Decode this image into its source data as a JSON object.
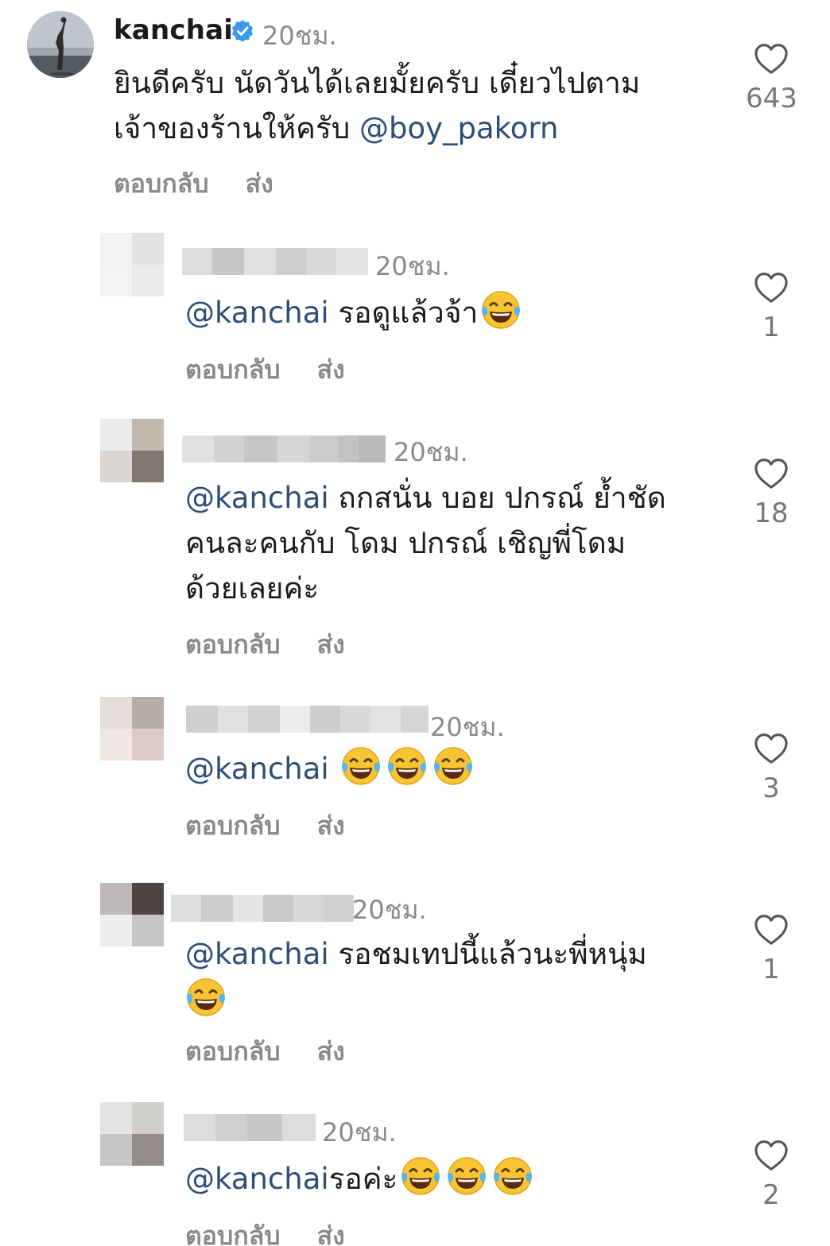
{
  "main_comment": {
    "username": "kanchai",
    "time": "20ชม.",
    "text_line1": "ยินดีครับ นัดวันได้เลยมั้ยครับ เดี๋ยวไปตาม",
    "text_line2": "เจ้าของร้านให้ครับ",
    "mention": "@boy_pakorn",
    "reply_label": "ตอบกลับ",
    "send_label": "ส่ง",
    "like_count": "643"
  },
  "replies": [
    {
      "time": "20ชม.",
      "mention": "@kanchai",
      "text": " รอดูแล้วจ้า",
      "reply_label": "ตอบกลับ",
      "send_label": "ส่ง",
      "like_count": "1",
      "emoji_count": 1
    },
    {
      "time": "20ชม.",
      "mention": "@kanchai",
      "text_line1": " ถกสนั่น บอย ปกรณ์ ย้ำชัด",
      "text_line2": "คนละคนกับ  โดม ปกรณ์  เชิญพี่โดม",
      "text_line3": "ด้วยเลยค่ะ",
      "reply_label": "ตอบกลับ",
      "send_label": "ส่ง",
      "like_count": "18"
    },
    {
      "time": "20ชม.",
      "mention": "@kanchai",
      "reply_label": "ตอบกลับ",
      "send_label": "ส่ง",
      "like_count": "3",
      "emoji_count": 3
    },
    {
      "time": "20ชม.",
      "mention": "@kanchai",
      "text": " รอชมเทปนี้แล้วนะพี่หนุ่ม",
      "reply_label": "ตอบกลับ",
      "send_label": "ส่ง",
      "like_count": "1",
      "emoji_count": 1
    },
    {
      "time": "20ชม.",
      "mention": "@kanchai",
      "text": "รอค่ะ",
      "reply_label": "ตอบกลับ",
      "send_label": "ส่ง",
      "like_count": "2",
      "emoji_count": 3
    }
  ],
  "icons": {
    "like": "heart-outline-icon",
    "verified": "verified-badge-icon",
    "emoji": "face-with-tears-of-joy-emoji"
  },
  "colors": {
    "mention": "#2b4f79",
    "verified": "#3797f0",
    "secondary_text": "#8a8a8a"
  }
}
